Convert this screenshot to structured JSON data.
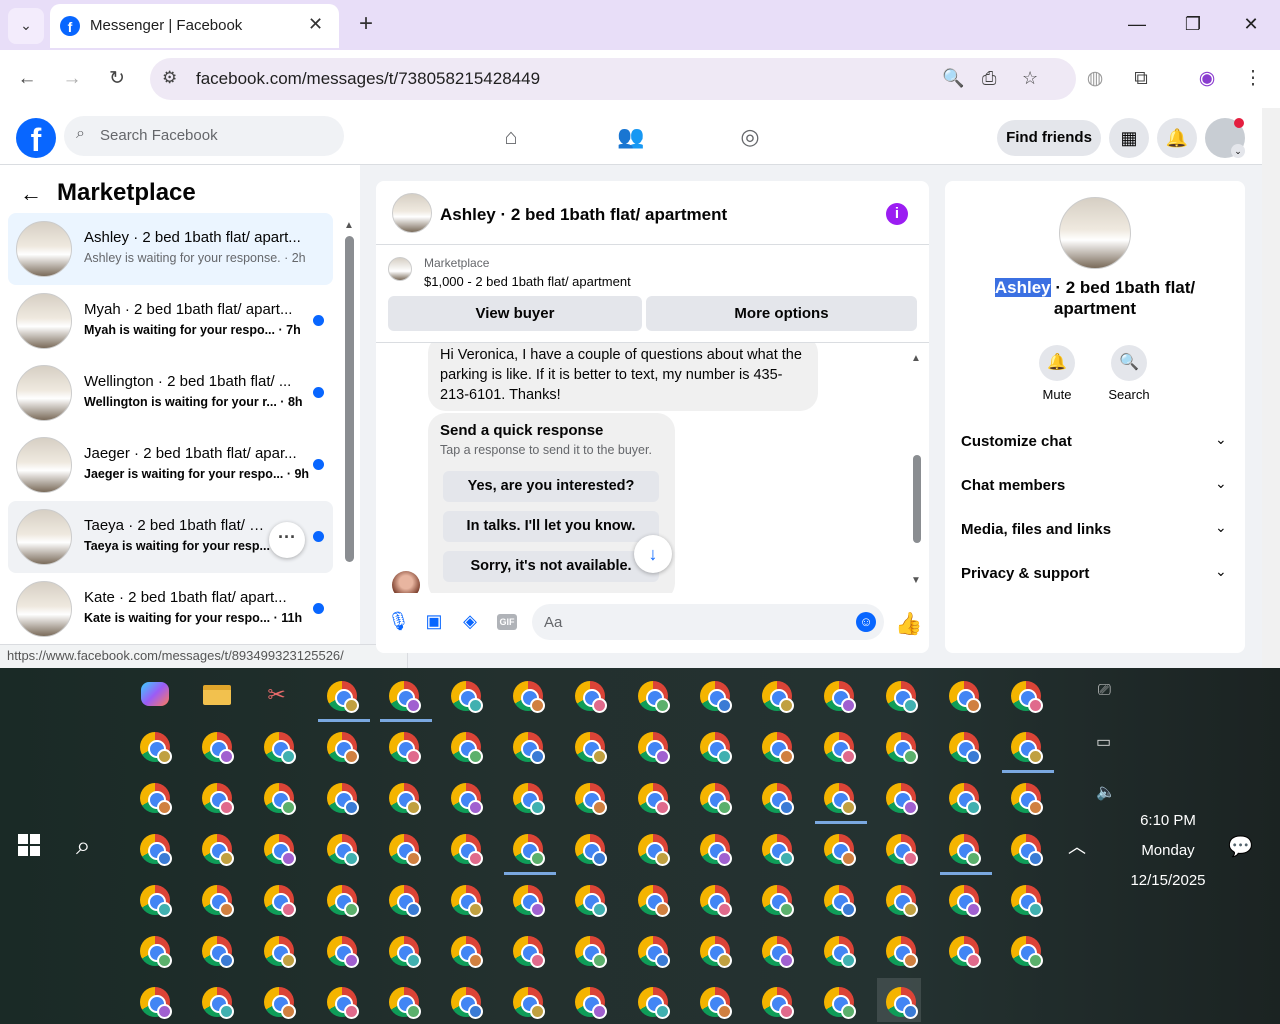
{
  "browser": {
    "tab_title": "Messenger | Facebook",
    "url": "facebook.com/messages/t/738058215428449",
    "status_url": "https://www.facebook.com/messages/t/893499323125526/"
  },
  "fb": {
    "search_placeholder": "Search Facebook",
    "find_friends": "Find friends"
  },
  "left": {
    "title": "Marketplace",
    "conversations": [
      {
        "name": "Ashley · 2 bed 1bath flat/ apart...",
        "sub": "Ashley is waiting for your response. · 2h"
      },
      {
        "name": "Myah · 2 bed 1bath flat/ apart...",
        "sub": "Myah is waiting for your respo... · 7h"
      },
      {
        "name": "Wellington · 2 bed 1bath flat/ ...",
        "sub": "Wellington is waiting for your r... · 8h"
      },
      {
        "name": "Jaeger · 2 bed 1bath flat/ apar...",
        "sub": "Jaeger is waiting for your respo... · 9h"
      },
      {
        "name": "Taeya · 2 bed 1bath flat/ apa...",
        "sub": "Taeya is waiting for your resp... · 10h"
      },
      {
        "name": "Kate · 2 bed 1bath flat/ apart...",
        "sub": "Kate is waiting for your respo... · 11h"
      }
    ]
  },
  "chat": {
    "title": "Ashley · 2 bed 1bath flat/ apartment",
    "marketplace_label": "Marketplace",
    "listing": "$1,000 - 2 bed 1bath flat/ apartment",
    "view_buyer": "View buyer",
    "more_options": "More options",
    "message": "Hi Veronica, I have a couple of questions about what the parking is like. If it is better to text, my number is 435-213-6101. Thanks!",
    "quick_title": "Send a quick response",
    "quick_sub": "Tap a response to send it to the buyer.",
    "quick_options": [
      "Yes, are you interested?",
      "In talks. I'll let you know.",
      "Sorry, it's not available."
    ],
    "input_placeholder": "Aa"
  },
  "right": {
    "name_highlight": "Ashley",
    "title_rest": " · 2 bed 1bath flat/ apartment",
    "mute": "Mute",
    "search": "Search",
    "rows": [
      "Customize chat",
      "Chat members",
      "Media, files and links",
      "Privacy & support"
    ]
  },
  "taskbar": {
    "time": "6:10 PM",
    "day": "Monday",
    "date": "12/15/2025"
  }
}
